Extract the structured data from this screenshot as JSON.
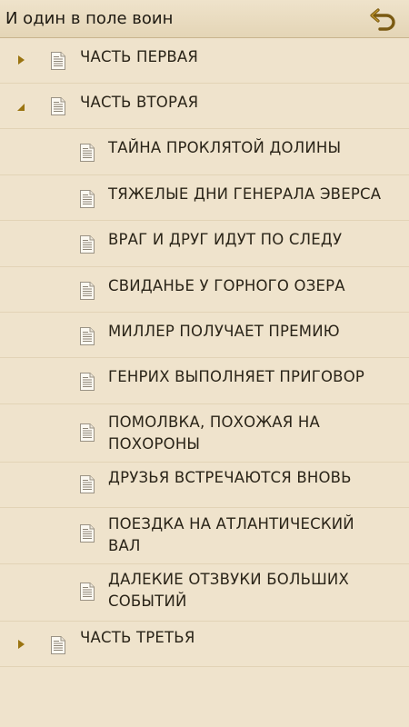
{
  "header": {
    "title": "И один в поле воин",
    "back_icon": "back-arrow-icon"
  },
  "colors": {
    "background": "#efe3cc",
    "accent": "#8a6a1f",
    "divider": "#e2d3b6"
  },
  "toc": {
    "part1": {
      "label": "ЧАСТЬ ПЕРВАЯ",
      "expanded": false
    },
    "part2": {
      "label": "ЧАСТЬ ВТОРАЯ",
      "expanded": true,
      "chapters": [
        {
          "label": "ТАЙНА ПРОКЛЯТОЙ ДОЛИНЫ"
        },
        {
          "label": "ТЯЖЕЛЫЕ ДНИ ГЕНЕРАЛА ЭВЕРСА"
        },
        {
          "label": "ВРАГ И ДРУГ ИДУТ ПО СЛЕДУ"
        },
        {
          "label": "СВИДАНЬЕ У ГОРНОГО ОЗЕРА"
        },
        {
          "label": "МИЛЛЕР ПОЛУЧАЕТ ПРЕМИЮ"
        },
        {
          "label": "ГЕНРИХ ВЫПОЛНЯЕТ ПРИГОВОР"
        },
        {
          "label": "ПОМОЛВКА, ПОХОЖАЯ НА ПОХОРОНЫ",
          "line1": "ПОМОЛВКА, ПОХОЖАЯ НА",
          "line2": "ПОХОРОНЫ"
        },
        {
          "label": "ДРУЗЬЯ ВСТРЕЧАЮТСЯ ВНОВЬ"
        },
        {
          "label": "ПОЕЗДКА НА АТЛАНТИЧЕСКИЙ ВАЛ",
          "line1": "ПОЕЗДКА НА АТЛАНТИЧЕСКИЙ",
          "line2": "ВАЛ"
        },
        {
          "label": "ДАЛЕКИЕ ОТЗВУКИ БОЛЬШИХ СОБЫТИЙ",
          "line1": "ДАЛЕКИЕ ОТЗВУКИ БОЛЬШИХ",
          "line2": "СОБЫТИЙ"
        }
      ]
    },
    "part3": {
      "label": "ЧАСТЬ ТРЕТЬЯ",
      "expanded": false
    }
  }
}
